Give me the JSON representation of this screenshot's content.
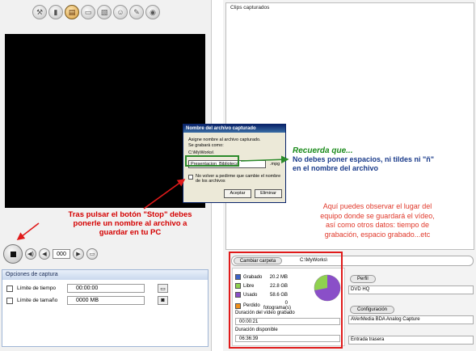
{
  "mode_bar": {
    "buttons": [
      {
        "icon": "tools-icon",
        "glyph": "⚒"
      },
      {
        "icon": "capture-icon",
        "glyph": "▮"
      },
      {
        "icon": "film-icon",
        "glyph": "▤"
      },
      {
        "icon": "tv-icon",
        "glyph": "▭"
      },
      {
        "icon": "photo-icon",
        "glyph": "▧"
      },
      {
        "icon": "person-icon",
        "glyph": "☺"
      },
      {
        "icon": "pen-icon",
        "glyph": "✎"
      },
      {
        "icon": "disc-icon",
        "glyph": "◉"
      }
    ],
    "active_index": 2
  },
  "controls": {
    "channel": "000",
    "prev_glyph": "◀",
    "next_glyph": "▶",
    "volume_glyph": "◀)",
    "snapshot_glyph": "▭"
  },
  "capture_options": {
    "header": "Opciones de captura",
    "time_limit_label": "Límite de tiempo",
    "time_limit_value": "00:00:00",
    "size_limit_label": "Límite de tamaño",
    "size_limit_value": "0000 MB"
  },
  "clips": {
    "title": "Clips capturados"
  },
  "folder": {
    "button_label": "Cambiar carpeta",
    "path": "C:\\MyWorks\\"
  },
  "disk": {
    "rows": [
      {
        "label": "Grabado",
        "value": "20.2 MB",
        "color": "#3a63c9"
      },
      {
        "label": "Libre",
        "value": "22.8 GB",
        "color": "#8fd14f"
      },
      {
        "label": "Usado",
        "value": "58.6 GB",
        "color": "#8a4fc8"
      },
      {
        "label": "Perdido",
        "value": "0 fotograma(s)",
        "color": "#f0901a"
      }
    ],
    "recorded_duration_label": "Duración del vídeo grabado",
    "recorded_duration_value": "00:00:21",
    "available_duration_label": "Duración disponible",
    "available_duration_value": "06:36:39",
    "used_fraction": 0.72
  },
  "profile": {
    "profile_label": "Perfil",
    "profile_value": "DVD HQ",
    "config_label": "Configuración",
    "config_value": "AVerMedia BDA Analog Capture",
    "input_value": "Entrada trasera"
  },
  "dialog": {
    "title": "Nombre del archivo capturado",
    "line1": "Asigne nombre al archivo capturado.",
    "line2": "Se grabará como:",
    "path": "C:\\MyWorks\\",
    "filename": "Presentacion_Biblioteca",
    "extension": ".mpg",
    "checkbox_line1": "No volver a pedirme que cambie el nombre",
    "checkbox_line2": "de los archivos",
    "accept_label": "Aceptar",
    "delete_label": "Eliminar"
  },
  "annotations": {
    "stop_note_1": "Tras pulsar el botón \"Stop\" debes",
    "stop_note_2": "ponerle un nombre al archivo a",
    "stop_note_3": "guardar en tu PC",
    "remember_head": "Recuerda que...",
    "remember_1": "No debes poner espacios, ni tildes ni \"ñ\"",
    "remember_2": "en el nombre del archivo",
    "info_1": "Aquí puedes observar el lugar del",
    "info_2": "equipo donde se guardará el vídeo,",
    "info_3": "así como  otros datos: tiempo de",
    "info_4": "grabación, espacio grabado...etc"
  },
  "colors": {
    "annotation_red": "#d40000",
    "annotation_green": "#2b8a2b",
    "annotation_blue": "#1a3b8a",
    "annotation_orange_red": "#e0392b"
  }
}
